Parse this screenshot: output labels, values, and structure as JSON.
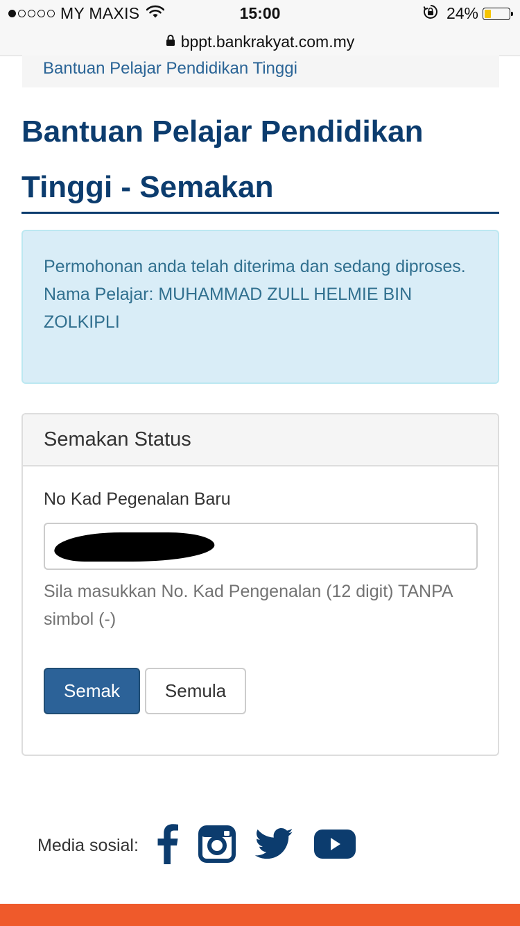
{
  "status_bar": {
    "carrier": "MY MAXIS",
    "time": "15:00",
    "battery_percent": "24%",
    "battery_level": 0.24,
    "signal_bars": 1,
    "signal_total": 5,
    "icons": [
      "wifi-icon",
      "orientation-lock-icon",
      "battery-icon"
    ]
  },
  "browser": {
    "url": "bppt.bankrakyat.com.my",
    "icon": "lock-icon"
  },
  "breadcrumb": {
    "label": "Bantuan Pelajar Pendidikan Tinggi"
  },
  "page": {
    "title": "Bantuan Pelajar Pendidikan Tinggi - Semakan",
    "title_color": "#0c3c6e"
  },
  "alert": {
    "message": "Permohonan anda telah diterima dan sedang diproses.",
    "student_line": "Nama Pelajar: MUHAMMAD ZULL HELMIE BIN ZOLKIPLI",
    "background": "#d9edf7",
    "text_color": "#31708f"
  },
  "panel": {
    "heading": "Semakan Status",
    "field_label": "No Kad Pegenalan Baru",
    "input_value": "",
    "input_redacted": true,
    "help_text": "Sila masukkan No. Kad Pengenalan (12 digit) TANPA simbol (-)",
    "submit_label": "Semak",
    "reset_label": "Semula",
    "primary_color": "#2c6298"
  },
  "social": {
    "label": "Media sosial:",
    "icons": [
      "facebook-icon",
      "instagram-icon",
      "twitter-icon",
      "youtube-icon"
    ],
    "icon_color": "#0c3c6e"
  },
  "footer": {
    "background": "#ef5a2b"
  }
}
